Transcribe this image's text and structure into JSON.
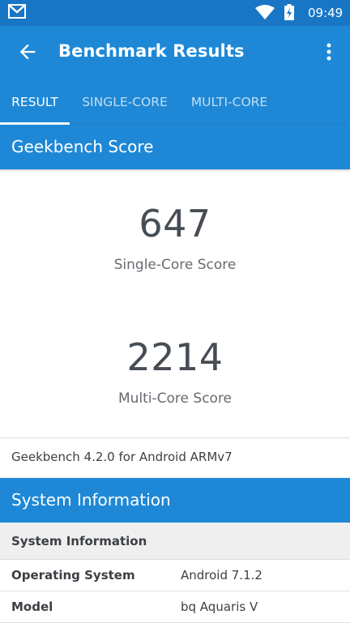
{
  "status_bar": {
    "time": "09:49",
    "icons": [
      "gmail-icon",
      "wifi-icon",
      "battery-charging-icon"
    ]
  },
  "app_bar": {
    "title": "Benchmark Results",
    "back_icon": "arrow-back-icon",
    "more_icon": "more-vert-icon"
  },
  "tabs": [
    {
      "label": "RESULT",
      "active": true
    },
    {
      "label": "SINGLE-CORE",
      "active": false
    },
    {
      "label": "MULTI-CORE",
      "active": false
    }
  ],
  "geekbench": {
    "header": "Geekbench Score",
    "single_score": "647",
    "single_label": "Single-Core Score",
    "multi_score": "2214",
    "multi_label": "Multi-Core Score",
    "version": "Geekbench 4.2.0 for Android ARMv7"
  },
  "system_info": {
    "header": "System Information",
    "subheader": "System Information",
    "rows": [
      {
        "key": "Operating System",
        "value": "Android 7.1.2"
      },
      {
        "key": "Model",
        "value": "bq Aquaris V"
      }
    ]
  },
  "colors": {
    "status_bar": "#1976c5",
    "primary": "#1e88d6",
    "score_text": "#474d55"
  }
}
